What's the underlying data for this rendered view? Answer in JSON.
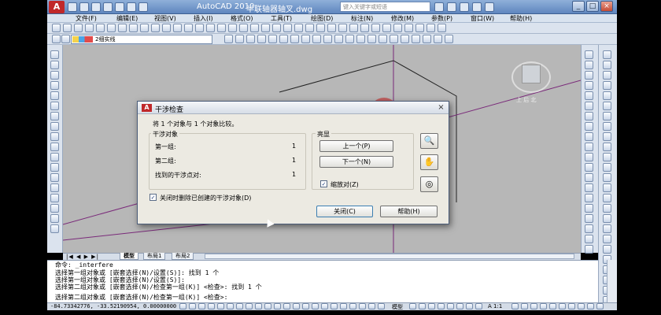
{
  "titlebar": {
    "app_title": "AutoCAD 2010",
    "doc_name": "半联轴器轴叉.dwg",
    "search_placeholder": "键入关键字或短语",
    "min_label": "_",
    "max_label": "□",
    "close_label": "×"
  },
  "menu": {
    "items": [
      "文件(F)",
      "编辑(E)",
      "视图(V)",
      "插入(I)",
      "格式(O)",
      "工具(T)",
      "绘图(D)",
      "标注(N)",
      "修改(M)",
      "参数(P)",
      "窗口(W)",
      "帮助(H)"
    ]
  },
  "toolbar": {
    "layer_value": "2细实线"
  },
  "viewcube": {
    "label": "上 后 北"
  },
  "tabs": {
    "model": "模型",
    "layout1": "布局1",
    "layout2": "布局2"
  },
  "command": {
    "lines": [
      "命令:  _interfere",
      "选择第一组对象或 [嵌套选择(N)/设置(S)]: 找到 1 个",
      "选择第一组对象或 [嵌套选择(N)/设置(S)]:",
      "选择第二组对象或 [嵌套选择(N)/检查第一组(K)] <检查>: 找到 1 个",
      "选择第二组对象或 [嵌套选择(N)/检查第一组(K)] <检查>:"
    ]
  },
  "status": {
    "coords": "-84.73342776,  -33.52190954, 0.00000000",
    "model_label": "模型",
    "scale": "A 1:1"
  },
  "dialog": {
    "title": "干涉检查",
    "compare_text": "将 1 个对象与 1 个对象比较。",
    "objects_header": "干涉对象",
    "first_group_label": "第一组:",
    "first_group_value": "1",
    "second_group_label": "第二组:",
    "second_group_value": "1",
    "pairs_label": "找到的干涉点对:",
    "pairs_value": "1",
    "highlight_header": "亮显",
    "prev_button": "上一个(P)",
    "next_button": "下一个(N)",
    "zoom_pair_label": "缩放对(Z)",
    "delete_on_close_label": "关闭时删除已创建的干涉对象(D)",
    "close_button": "关闭(C)",
    "help_button": "帮助(H)",
    "check_mark": "✓"
  }
}
